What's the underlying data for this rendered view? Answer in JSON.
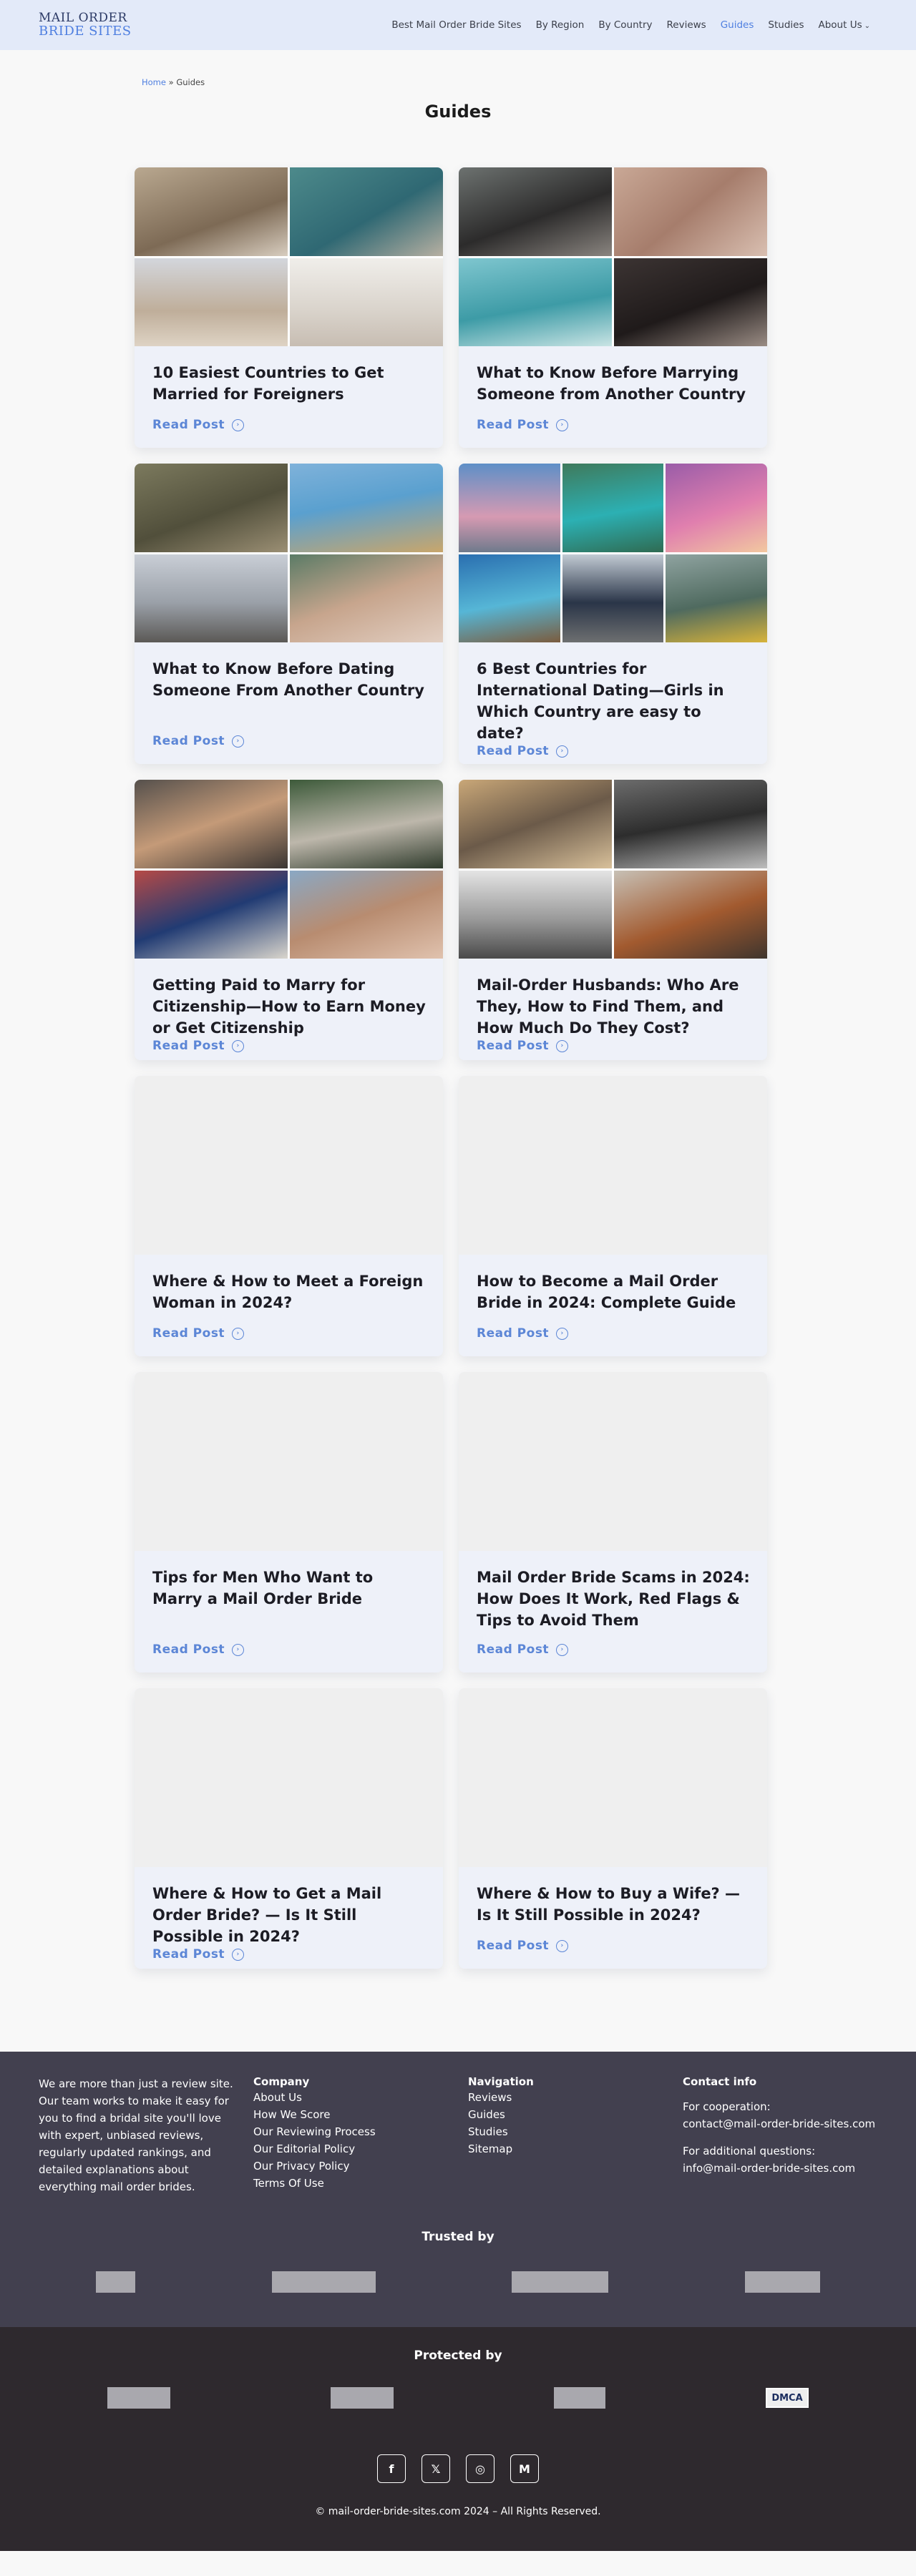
{
  "header": {
    "logo_top": "MAIL ORDER",
    "logo_bottom": "BRIDE SITES",
    "nav": [
      {
        "label": "Best Mail Order Bride Sites"
      },
      {
        "label": "By Region"
      },
      {
        "label": "By Country"
      },
      {
        "label": "Reviews"
      },
      {
        "label": "Guides",
        "active": true
      },
      {
        "label": "Studies"
      },
      {
        "label": "About Us",
        "dropdown": true
      }
    ]
  },
  "breadcrumb": {
    "home": "Home",
    "separator": "»",
    "current": "Guides"
  },
  "page_title": "Guides",
  "posts": [
    {
      "title": "10 Easiest Countries to Get Married for Foreigners",
      "read": "Read Post"
    },
    {
      "title": "What to Know Before Marrying Someone from Another Country",
      "read": "Read Post"
    },
    {
      "title": "What to Know Before Dating Someone From Another Country",
      "read": "Read Post"
    },
    {
      "title": "6 Best Countries for International Dating—Girls in Which Country are easy to date?",
      "read": "Read Post"
    },
    {
      "title": "Getting Paid to Marry for Citizenship—How to Earn Money or Get Citizenship",
      "read": "Read Post"
    },
    {
      "title": "Mail-Order Husbands: Who Are They, How to Find Them, and How Much Do They Cost?",
      "read": "Read Post"
    },
    {
      "title": "Where & How to Meet a Foreign Woman in 2024?",
      "read": "Read Post"
    },
    {
      "title": "How to Become a Mail Order Bride in 2024: Complete Guide",
      "read": "Read Post"
    },
    {
      "title": "Tips for Men Who Want to Marry a Mail Order Bride",
      "read": "Read Post"
    },
    {
      "title": "Mail Order Bride Scams in 2024: How Does It Work, Red Flags & Tips to Avoid Them",
      "read": "Read Post"
    },
    {
      "title": "Where & How to Get a Mail Order Bride? — Is It Still Possible in 2024?",
      "read": "Read Post"
    },
    {
      "title": "Where & How to Buy a Wife? — Is It Still Possible in 2024?",
      "read": "Read Post"
    }
  ],
  "footer": {
    "about": "We are more than just a review site. Our team works to make it easy for you to find a bridal site you'll love with expert, unbiased reviews, regularly updated rankings, and detailed explanations about everything mail order brides.",
    "company": {
      "heading": "Company",
      "links": [
        "About Us",
        "How We Score",
        "Our Reviewing Process",
        "Our Editorial Policy",
        "Our Privacy Policy",
        "Terms Of Use"
      ]
    },
    "navigation": {
      "heading": "Navigation",
      "links": [
        "Reviews",
        "Guides",
        "Studies",
        "Sitemap"
      ]
    },
    "contact": {
      "heading": "Contact info",
      "coop_label": "For cooperation:",
      "coop_email": "contact@mail-order-bride-sites.com",
      "questions_label": "For additional questions:",
      "questions_email": "info@mail-order-bride-sites.com"
    },
    "trusted_heading": "Trusted by",
    "protected_heading": "Protected by",
    "dmca": "DMCA",
    "socials": [
      {
        "icon": "facebook-icon",
        "glyph": "f"
      },
      {
        "icon": "x-icon",
        "glyph": "𝕏"
      },
      {
        "icon": "instagram-icon",
        "glyph": "◎"
      },
      {
        "icon": "medium-icon",
        "glyph": "M"
      }
    ],
    "copyright": "© mail-order-bride-sites.com 2024 – All Rights Reserved."
  },
  "colors": {
    "accent": "#4f7fe0",
    "header_bg": "#e3eaf9",
    "card_bg": "#eef1f9",
    "footer_bg": "#42404f",
    "footer_bottom_bg": "#2e292e"
  }
}
